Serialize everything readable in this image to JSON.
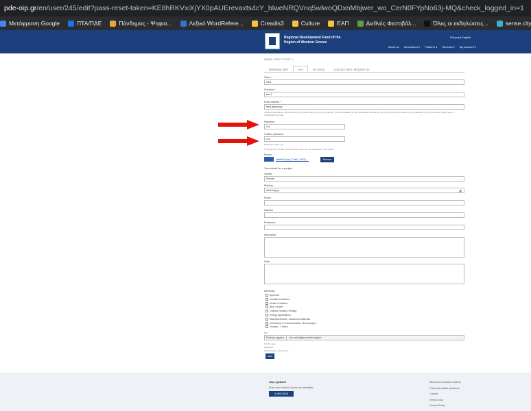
{
  "browser": {
    "url_host": "pde-oip.gr",
    "url_rest": "/en/user/245/edit?pass-reset-token=KE8hRKVxiXjYX0pAUErevaxts4cY_blweNRQVnq5wlwoQDxnMbjwer_wo_CerN0FYpNo63j-MQ&check_logged_in=1",
    "bookmarks": [
      {
        "label": "Μετάφραση Google",
        "color": "#4285f4"
      },
      {
        "label": "ΠΤΑ/ΠΔΕ",
        "color": "#1a73e8"
      },
      {
        "label": "Πάνδημος - Ψηφια...",
        "color": "#e8a33d"
      },
      {
        "label": "Λεξικό WordRefere...",
        "color": "#3b6fd1"
      },
      {
        "label": "Creadis3",
        "color": "#f4c542"
      },
      {
        "label": "Culture",
        "color": "#f4c542"
      },
      {
        "label": "ΕΑΠ",
        "color": "#f4c542"
      },
      {
        "label": "Διεθνές Φεστιβάλ...",
        "color": "#5a9f4a"
      },
      {
        "label": "Όλες οι εκδηλώσεις...",
        "color": "#111111"
      },
      {
        "label": "sense.city",
        "color": "#3bb0c9"
      }
    ]
  },
  "site": {
    "brand_line1": "Regional Development Fund of the",
    "brand_line2": "Region of Western Greece",
    "lang": "Ελληνικά English",
    "nav": [
      "About us",
      "Information ▾",
      "Platform ▾",
      "Services ▾",
      "My Account ▾"
    ]
  },
  "form": {
    "breadcrumb": "HOME / TEST1 TEST 1",
    "tabs": [
      "PERSONAL INFO",
      "EDIT",
      "MY IDEAS",
      "CONTACT INFO / REQUEST DE"
    ],
    "name_label": "Name *",
    "name_value": "test1",
    "surname_label": "Surname *",
    "surname_value": "test 1",
    "email_label": "Email address *",
    "email_value": "test1@gmail.gr",
    "email_help": "A valid email address. All emails from the system will be sent to this address. The email address is not made public and will only be used if you wish to receive a new password or wish to receive certain news or notifications by email.",
    "password_label": "Password",
    "password_value": "•••••",
    "confirm_label": "Confirm password",
    "confirm_value": "•••••",
    "strength": "Password match: yes",
    "pw_help": "To change the current user password, enter the new password in both fields.",
    "picture_label": "Picture",
    "picture_file": "Untitled3.png (7.6kb), 1093 | ...",
    "remove_button": "Remove",
    "personal_heading": "Your detail for a project",
    "gender_label": "Gender",
    "gender_value": "Female",
    "birthday_label": "Birthday",
    "birthday_value": "dd/mm/yyyy",
    "phone_label": "Phone",
    "address_label": "Address",
    "profession_label": "Profession",
    "description_label": "Description",
    "skills_label": "Skills",
    "interests_heading": "Interests",
    "interests": [
      "Agrofood",
      "Creative Industries",
      "Health & Welfare",
      "Blue Growth",
      "Cultural Tourism Heritage",
      "Energy Applications",
      "Microelectronics - Advanced Materials",
      "Information & Communication Technologies",
      "Tourism - Culture"
    ],
    "file_label": "CV",
    "file_button": "Επιλογή αρχείου",
    "file_status": "Δεν επιλέχθηκε κανένα αρχείο",
    "consent_1": "Set the copy",
    "consent_2": "Published",
    "consent_3": "Allowed types: txt pdf docx",
    "save_button": "Save"
  },
  "footer": {
    "title": "Stay updated",
    "text": "Enter your email to receive our newsletter",
    "subscribe_button": "SUBSCRIBE",
    "links": [
      "About the Innovation Platform",
      "Frequently Asked Questions",
      "Contact",
      "Terms of use",
      "Cookies Policy"
    ]
  }
}
